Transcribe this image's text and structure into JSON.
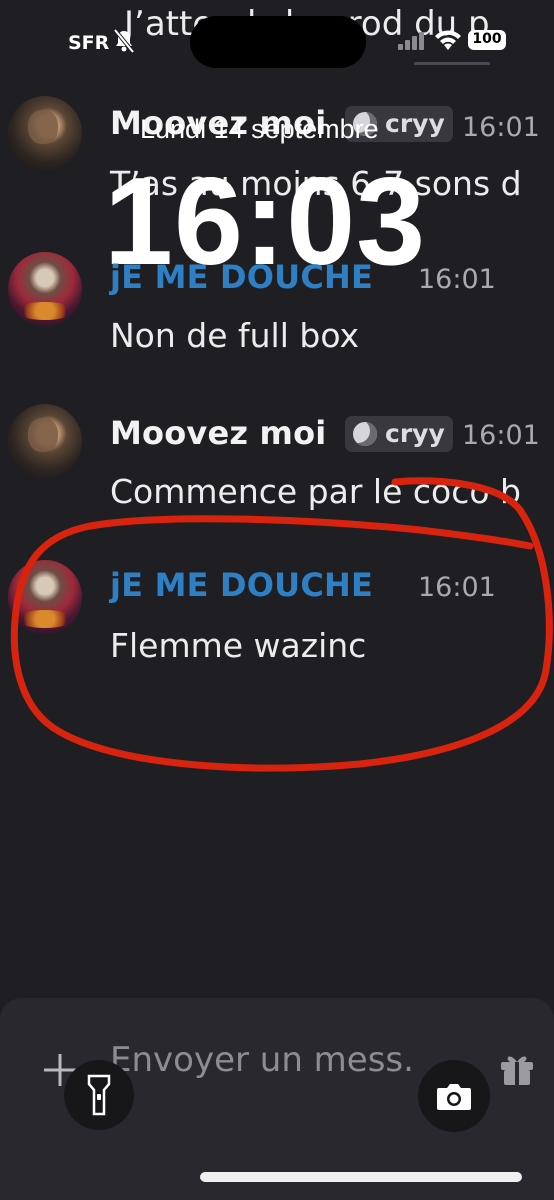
{
  "status_bar": {
    "carrier": "SFR",
    "battery": "100",
    "top_partial_text": "J’attends le prod du p"
  },
  "lock_screen": {
    "date": "Lundi 14 septembre",
    "time": "16:03"
  },
  "messages": [
    {
      "author": "Moovez moi",
      "tag": "cryy",
      "time": "16:01",
      "text": "T’as au moins 6-7 sons d"
    },
    {
      "author": "jE ME DOUCHE",
      "time": "16:01",
      "text": "Non de full box"
    },
    {
      "author": "Moovez moi",
      "tag": "cryy",
      "time": "16:01",
      "text": "Commence par le coco b"
    },
    {
      "author": "jE ME DOUCHE",
      "time": "16:01",
      "text": "Flemme wazinc"
    }
  ],
  "composer": {
    "placeholder": "Envoyer un mess."
  },
  "colors": {
    "background": "#1f1f23",
    "author_blue": "#2e7fc4",
    "annotation_red": "#d8230f"
  },
  "icons": [
    "mute-bell-icon",
    "signal-icon",
    "wifi-icon",
    "battery-icon",
    "moon-emoji-icon",
    "plus-icon",
    "flashlight-icon",
    "camera-icon",
    "gift-icon"
  ]
}
